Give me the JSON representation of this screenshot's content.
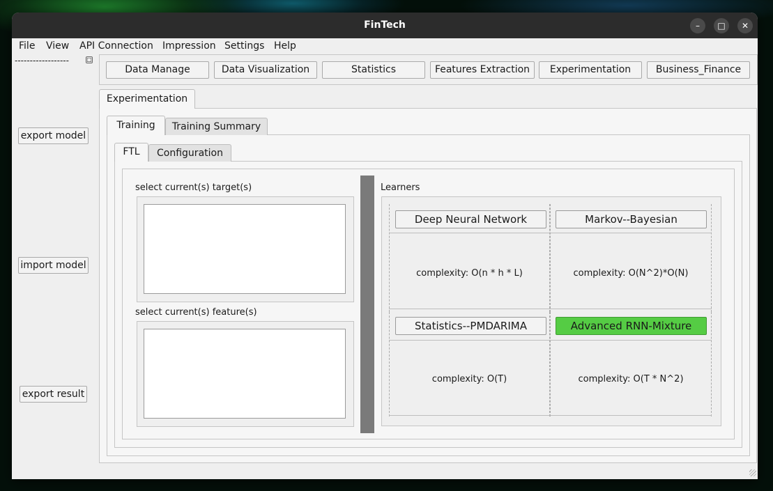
{
  "window": {
    "title": "FinTech"
  },
  "menu": [
    "File",
    "View",
    "API Connection",
    "Impression",
    "Settings",
    "Help"
  ],
  "sidebar": {
    "header": "------------------",
    "buttons": {
      "export_model": "export model",
      "import_model": "import model",
      "export_result": "export result"
    }
  },
  "toolbar": [
    "Data Manage",
    "Data Visualization",
    "Statistics",
    "Features Extraction",
    "Experimentation",
    "Business_Finance"
  ],
  "tabs": {
    "main": "Experimentation",
    "level2": [
      "Training",
      "Training Summary"
    ],
    "level3": [
      "FTL",
      "Configuration"
    ]
  },
  "selectors": {
    "target_label": "select current(s) target(s)",
    "feature_label": "select current(s) feature(s)"
  },
  "learners": {
    "title": "Learners",
    "items": [
      {
        "name": "Deep Neural Network",
        "complexity": "complexity:  O(n * h * L)"
      },
      {
        "name": "Markov--Bayesian",
        "complexity": "complexity: O(N^2)*O(N)"
      },
      {
        "name": "Statistics--PMDARIMA",
        "complexity": "complexity:  O(T)"
      },
      {
        "name": "Advanced RNN-Mixture",
        "complexity": "complexity:  O(T * N^2)"
      }
    ]
  },
  "colors": {
    "selected_learner": "#55cc44",
    "titlebar": "#2c2c2c",
    "splitter": "#7a7a7a"
  }
}
